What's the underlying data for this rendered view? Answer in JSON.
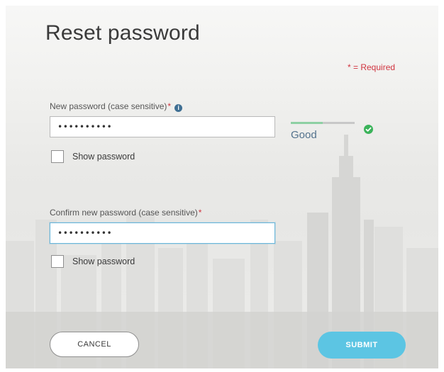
{
  "form": {
    "title": "Reset password",
    "required_note": "* = Required",
    "required_marker": "*",
    "new_password": {
      "label": "New password (case sensitive)",
      "value": "••••••••••",
      "info_icon": "info-icon",
      "show_password_label": "Show password",
      "strength": {
        "label": "Good",
        "level": 0.5,
        "fill_color": "#8ed0a3",
        "check_icon": "check-icon",
        "check_color": "#3bb35a"
      }
    },
    "confirm_password": {
      "label": "Confirm new password (case sensitive)",
      "value": "••••••••••",
      "show_password_label": "Show password"
    },
    "buttons": {
      "cancel": "CANCEL",
      "submit": "SUBMIT"
    }
  },
  "colors": {
    "required": "#d0343f",
    "accent": "#5cc5e3",
    "focus_border": "#6ab6da"
  }
}
